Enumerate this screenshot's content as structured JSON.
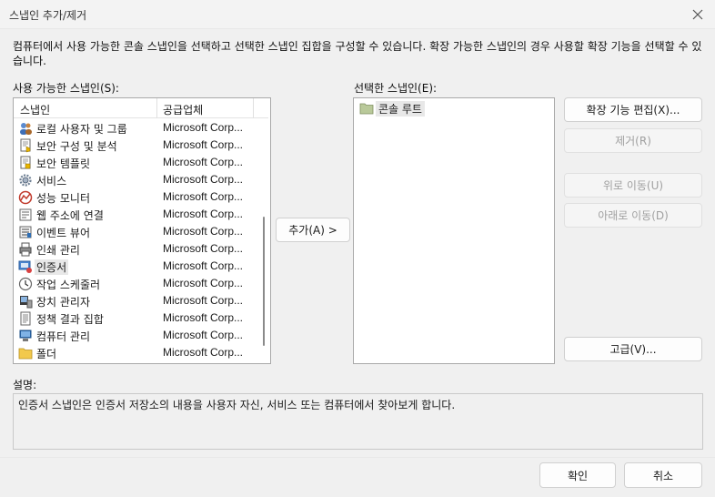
{
  "window": {
    "title": "스냅인 추가/제거"
  },
  "description": "컴퓨터에서 사용 가능한 콘솔 스냅인을 선택하고 선택한 스냅인 집합을 구성할 수 있습니다. 확장 가능한 스냅인의 경우 사용할 확장 기능을 선택할 수 있습니다.",
  "available": {
    "label": "사용 가능한 스냅인(S):",
    "col_name": "스냅인",
    "col_vendor": "공급업체",
    "items": [
      {
        "name": "로컬 사용자 및 그룹",
        "vendor": "Microsoft Corp...",
        "icon": "users-icon"
      },
      {
        "name": "보안 구성 및 분석",
        "vendor": "Microsoft Corp...",
        "icon": "security-analysis-icon"
      },
      {
        "name": "보안 템플릿",
        "vendor": "Microsoft Corp...",
        "icon": "security-template-icon"
      },
      {
        "name": "서비스",
        "vendor": "Microsoft Corp...",
        "icon": "services-gear-icon"
      },
      {
        "name": "성능 모니터",
        "vendor": "Microsoft Corp...",
        "icon": "performance-monitor-icon"
      },
      {
        "name": "웹 주소에 연결",
        "vendor": "Microsoft Corp...",
        "icon": "web-link-icon"
      },
      {
        "name": "이벤트 뷰어",
        "vendor": "Microsoft Corp...",
        "icon": "event-viewer-icon"
      },
      {
        "name": "인쇄 관리",
        "vendor": "Microsoft Corp...",
        "icon": "printer-icon"
      },
      {
        "name": "인증서",
        "vendor": "Microsoft Corp...",
        "icon": "certificate-icon",
        "selected": true
      },
      {
        "name": "작업 스케줄러",
        "vendor": "Microsoft Corp...",
        "icon": "clock-icon"
      },
      {
        "name": "장치 관리자",
        "vendor": "Microsoft Corp...",
        "icon": "device-manager-icon"
      },
      {
        "name": "정책 결과 집합",
        "vendor": "Microsoft Corp...",
        "icon": "policy-result-icon"
      },
      {
        "name": "컴퓨터 관리",
        "vendor": "Microsoft Corp...",
        "icon": "computer-management-icon"
      },
      {
        "name": "폴더",
        "vendor": "Microsoft Corp...",
        "icon": "folder-icon"
      }
    ]
  },
  "add_button": "추가(A) >",
  "selected": {
    "label": "선택한 스냅인(E):",
    "items": [
      {
        "name": "콘솔 루트",
        "icon": "folder-icon"
      }
    ]
  },
  "side_buttons": {
    "edit_extensions": "확장 기능 편집(X)...",
    "remove": "제거(R)",
    "move_up": "위로 이동(U)",
    "move_down": "아래로 이동(D)",
    "advanced": "고급(V)..."
  },
  "info": {
    "label": "설명:",
    "text": "인증서 스냅인은 인증서 저장소의 내용을 사용자 자신, 서비스 또는 컴퓨터에서 찾아보게 합니다."
  },
  "footer": {
    "ok": "확인",
    "cancel": "취소"
  }
}
